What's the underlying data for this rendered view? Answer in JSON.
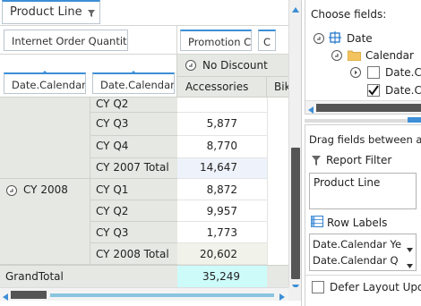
{
  "filter": {
    "label": "Product Line",
    "icon": "filter-dropdown-icon"
  },
  "data_fields": [
    "Internet Order Quantity"
  ],
  "column_fields": [
    "Promotion C",
    "C"
  ],
  "row_fields": [
    "Date.Calendar",
    "Date.Calendar"
  ],
  "column_header": {
    "group": "No Discount",
    "sub1": "Accessories",
    "sub2": "Bik"
  },
  "rows": [
    {
      "year": "",
      "period": "CY Q2",
      "value": ""
    },
    {
      "year": "",
      "period": "CY Q3",
      "value": "5,877"
    },
    {
      "year": "",
      "period": "CY Q4",
      "value": "8,770"
    },
    {
      "year": "",
      "period": "CY 2007 Total",
      "value": "14,647"
    },
    {
      "year": "CY 2008",
      "period": "CY Q1",
      "value": "8,872"
    },
    {
      "year": "",
      "period": "CY Q2",
      "value": "9,957"
    },
    {
      "year": "",
      "period": "CY Q3",
      "value": "1,773"
    },
    {
      "year": "",
      "period": "CY 2008 Total",
      "value": "20,602"
    }
  ],
  "grand_total": {
    "label": "GrandTotal",
    "value": "35,249"
  },
  "field_list": {
    "choose_title": "Choose fields:",
    "tree": [
      "Date",
      "Calendar",
      "Date.Cal",
      "Date.Cal"
    ],
    "drag_title": "Drag fields between area",
    "report_filter_label": "Report Filter",
    "report_filter_items": [
      "Product Line"
    ],
    "row_labels_label": "Row Labels",
    "row_label_items": [
      "Date.Calendar Ye",
      "Date.Calendar Q"
    ],
    "defer_label": "Defer Layout Update"
  },
  "colors": {
    "accent": "#3d8fd6",
    "row_header_bg": "#e6e8e3",
    "total_bg": "#eef2fa",
    "grand_total_value_bg": "#ccfbfa"
  }
}
